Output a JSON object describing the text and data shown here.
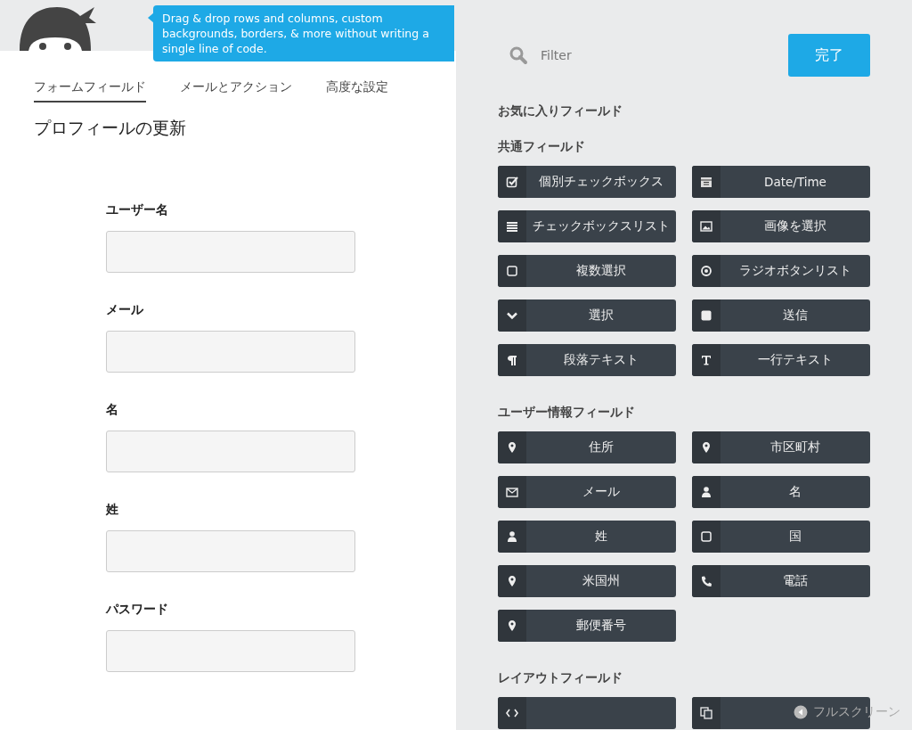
{
  "tooltip": "Drag & drop rows and columns, custom backgrounds, borders, & more without writing a single line of code.",
  "tabs": [
    {
      "label": "フォームフィールド",
      "selected": true
    },
    {
      "label": "メールとアクション",
      "selected": false
    },
    {
      "label": "高度な設定",
      "selected": false
    }
  ],
  "form_title": "プロフィールの更新",
  "form_fields": [
    {
      "label": "ユーザー名"
    },
    {
      "label": "メール"
    },
    {
      "label": "名"
    },
    {
      "label": "姓"
    },
    {
      "label": "パスワード"
    }
  ],
  "filter": {
    "placeholder": "Filter"
  },
  "done_button": "完了",
  "favorites_heading": "お気に入りフィールド",
  "sections": [
    {
      "heading": "共通フィールド",
      "fields": [
        {
          "label": "個別チェックボックス",
          "kind": "checkbox"
        },
        {
          "label": "Date/Time",
          "kind": "calendar"
        },
        {
          "label": "チェックボックスリスト",
          "kind": "list"
        },
        {
          "label": "画像を選択",
          "kind": "image"
        },
        {
          "label": "複数選択",
          "kind": "square"
        },
        {
          "label": "ラジオボタンリスト",
          "kind": "radio"
        },
        {
          "label": "選択",
          "kind": "chevron"
        },
        {
          "label": "送信",
          "kind": "filled"
        },
        {
          "label": "段落テキスト",
          "kind": "paragraph"
        },
        {
          "label": "一行テキスト",
          "kind": "text"
        }
      ]
    },
    {
      "heading": "ユーザー情報フィールド",
      "fields": [
        {
          "label": "住所",
          "kind": "pin"
        },
        {
          "label": "市区町村",
          "kind": "pin"
        },
        {
          "label": "メール",
          "kind": "envelope"
        },
        {
          "label": "名",
          "kind": "person"
        },
        {
          "label": "姓",
          "kind": "person"
        },
        {
          "label": "国",
          "kind": "square"
        },
        {
          "label": "米国州",
          "kind": "pin"
        },
        {
          "label": "電話",
          "kind": "phone"
        },
        {
          "label": "郵便番号",
          "kind": "pin"
        }
      ]
    },
    {
      "heading": "レイアウトフィールド",
      "fields": [
        {
          "kind": "code"
        },
        {
          "kind": "copy"
        }
      ]
    }
  ],
  "fullscreen_link": "フルスクリーン"
}
